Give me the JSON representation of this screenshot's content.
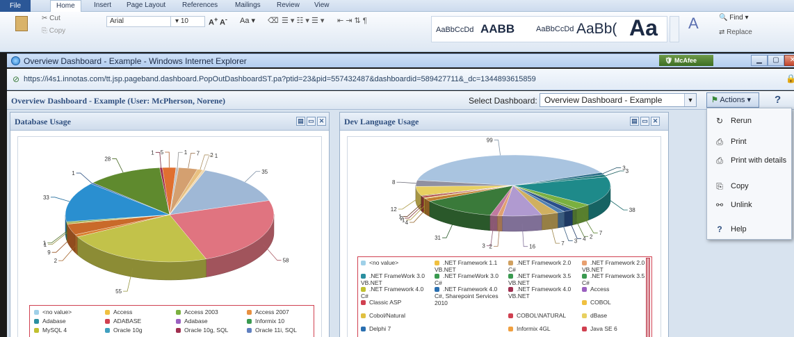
{
  "word": {
    "tabs": [
      "File",
      "Home",
      "Insert",
      "Page Layout",
      "References",
      "Mailings",
      "Review",
      "View"
    ],
    "font_name": "Arial",
    "font_size": "10",
    "cut_label": "Cut",
    "copy_label": "Copy",
    "styles": [
      "AaBbCcDd",
      "AABB",
      "AaBbCcDd",
      "AaBb(",
      "Aa"
    ],
    "find_label": "Find",
    "replace_label": "Replace"
  },
  "ie": {
    "title": "Overview Dashboard - Example - Windows Internet Explorer",
    "url": "https://i4s1.innotas.com/tt.jsp.pageband.dashboard.PopOutDashboardST.pa?ptid=23&pid=557432487&dashboardid=589427711&_dc=1344893615859",
    "mcafee": "McAfee"
  },
  "app": {
    "header_title": "Overview Dashboard - Example (User: McPherson, Norene)",
    "select_label": "Select Dashboard:",
    "select_value": "Overview Dashboard - Example",
    "actions_label": "Actions",
    "help_symbol": "?"
  },
  "menu": {
    "items": [
      {
        "label": "Rerun",
        "icon": "refresh-icon"
      },
      {
        "label": "Print",
        "icon": "printer-icon"
      },
      {
        "label": "Print with details",
        "icon": "printer-icon"
      },
      {
        "label": "Copy",
        "icon": "copy-icon"
      },
      {
        "label": "Unlink",
        "icon": "unlink-icon"
      },
      {
        "label": "Help",
        "icon": "help-icon"
      }
    ]
  },
  "panels": {
    "db_title": "Database Usage",
    "dev_title": "Dev Language Usage"
  },
  "chart_data": [
    {
      "type": "pie",
      "title": "Database Usage",
      "slices": [
        {
          "label": "<no value>",
          "value": 35,
          "color": "#9fb8d6"
        },
        {
          "label": "Access",
          "value": 58,
          "color": "#e07480"
        },
        {
          "label": "Access 2003",
          "value": 55,
          "color": "#c2c24a"
        },
        {
          "label": "Access 2007",
          "value": 2,
          "color": "#d98030"
        },
        {
          "label": "Adabase",
          "value": 9,
          "color": "#c96a2a"
        },
        {
          "label": "ADABASE",
          "value": 1,
          "color": "#b8b040"
        },
        {
          "label": "Adabase",
          "value": 1,
          "color": "#6d9a3a"
        },
        {
          "label": "Informix 10",
          "value": 33,
          "color": "#2a8fd0"
        },
        {
          "label": "MySQL 4",
          "value": 1,
          "color": "#3e6fb0"
        },
        {
          "label": "Oracle 10g",
          "value": 28,
          "color": "#5f8a2e"
        },
        {
          "label": "Oracle 10g, SQL",
          "value": 1,
          "color": "#a03050"
        },
        {
          "label": "Oracle 11i, SQL",
          "value": 5,
          "color": "#e07030"
        },
        {
          "label": "",
          "value": 1,
          "color": "#c0c0c0"
        },
        {
          "label": "",
          "value": 7,
          "color": "#d4a070"
        },
        {
          "label": "",
          "value": 2,
          "color": "#e8c080"
        },
        {
          "label": "",
          "value": 1,
          "color": "#f0d8b0"
        }
      ],
      "legend": [
        [
          "<no value>",
          "Access",
          "Access 2003",
          "Access 2007"
        ],
        [
          "Adabase",
          "ADABASE",
          "Adabase",
          "Informix 10"
        ],
        [
          "MySQL 4",
          "Oracle 10g",
          "Oracle 10g, SQL",
          "Oracle 11i, SQL"
        ]
      ],
      "legend_colors": [
        [
          "#9fd0e8",
          "#f0c040",
          "#7ab040",
          "#e89040"
        ],
        [
          "#2a8fa0",
          "#d04050",
          "#9a60c0",
          "#3a9a50"
        ],
        [
          "#c0c030",
          "#40a0c0",
          "#a03050",
          "#6080c0"
        ]
      ]
    },
    {
      "type": "pie",
      "title": "Dev Language Usage",
      "slices": [
        {
          "label": "<no value>",
          "value": 99,
          "color": "#a9c4e0"
        },
        {
          "label": ".NET FrameWork 3.0 VB.NET",
          "value": 3,
          "color": "#2e6f8a"
        },
        {
          "label": ".NET Framework 4.0 C#",
          "value": 3,
          "color": "#1f7a7a"
        },
        {
          "label": "Classic ASP",
          "value": 38,
          "color": "#1e8a8a"
        },
        {
          "label": "Cobol/Natural",
          "value": 7,
          "color": "#7ab040"
        },
        {
          "label": "Delphi 7",
          "value": 2,
          "color": "#6a9a40"
        },
        {
          "label": ".NET Framework 1.1 VB.NET",
          "value": 4,
          "color": "#2a4f8a"
        },
        {
          "label": ".NET FrameWork 3.0 C#",
          "value": 3,
          "color": "#5080b0"
        },
        {
          "label": ".NET Framework 4.0 C#, Sharepoint Services 2010",
          "value": 7,
          "color": "#d0b060"
        },
        {
          "label": "Informix 4GL",
          "value": 16,
          "color": "#b09ad0"
        },
        {
          "label": ".NET Framework 2.0 C#",
          "value": 2,
          "color": "#e0a070"
        },
        {
          "label": ".NET Framework 3.5 VB.NET",
          "value": 3,
          "color": "#c07aa0"
        },
        {
          "label": ".NET Framework 4.0 VB.NET",
          "value": 31,
          "color": "#3a7a3a"
        },
        {
          "label": "COBOL\\NATURAL",
          "value": 4,
          "color": "#c08030"
        },
        {
          "label": ".NET Framework 2.0 VB.NET",
          "value": 1,
          "color": "#e0c040"
        },
        {
          "label": ".NET Framework 3.5 C#",
          "value": 2,
          "color": "#b04040"
        },
        {
          "label": "Access",
          "value": 1,
          "color": "#8a5030"
        },
        {
          "label": "COBOL",
          "value": 12,
          "color": "#e8d060"
        },
        {
          "label": "dBase",
          "value": 8,
          "color": "#9090a0"
        }
      ],
      "legend": [
        [
          "<no value>",
          ".NET Framework 1.1 VB.NET",
          ".NET Framework 2.0 C#",
          ".NET Framework 2.0 VB.NET"
        ],
        [
          ".NET FrameWork 3.0 VB.NET",
          ".NET FrameWork 3.0 C#",
          ".NET Framework 3.5 VB.NET",
          ".NET Framework 3.5 C#"
        ],
        [
          ".NET Framework 4.0 C#",
          ".NET Framework 4.0 C#, Sharepoint Services 2010",
          ".NET Framework 4.0 VB.NET",
          "Access"
        ],
        [
          "Classic ASP",
          "",
          "",
          "COBOL"
        ],
        [
          "Cobol/Natural",
          "",
          "COBOL\\NATURAL",
          "dBase"
        ],
        [
          "Delphi 7",
          "",
          "Informix 4GL",
          "Java SE 6"
        ]
      ],
      "legend_colors": [
        [
          "#9fd0e8",
          "#f0c040",
          "#d0a060",
          "#e8a070"
        ],
        [
          "#2a8fa0",
          "#3a9a50",
          "#3a9a50",
          "#3a9a50"
        ],
        [
          "#c0c030",
          "#2a6fb0",
          "#a03050",
          "#9a60c0"
        ],
        [
          "#d04050",
          "",
          "",
          "#f0c040"
        ],
        [
          "#e0c040",
          "",
          "#d04050",
          "#e8d060"
        ],
        [
          "#2a6fb0",
          "",
          "#f0a040",
          "#d04050"
        ]
      ]
    }
  ]
}
